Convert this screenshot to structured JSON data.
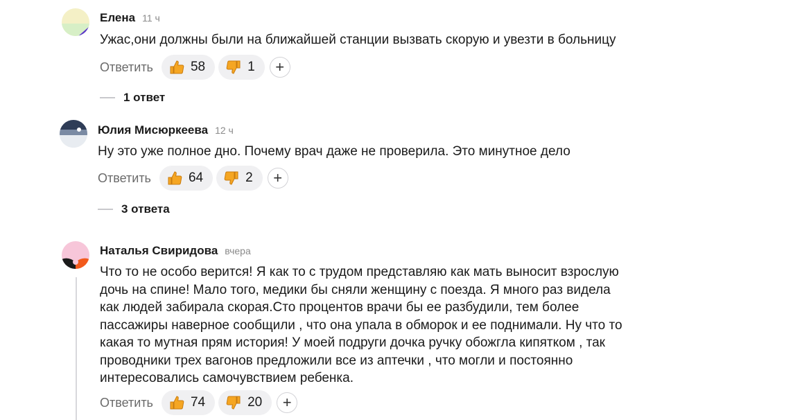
{
  "comments": [
    {
      "author": "Елена",
      "time": "11 ч",
      "text": "Ужас,они должны были на ближайшей станции вызвать скорую и увезти в больницу",
      "reply_label": "Ответить",
      "likes": "58",
      "dislikes": "1",
      "replies": "1 ответ"
    },
    {
      "author": "Юлия Мисюркеева",
      "time": "12 ч",
      "text": "Ну это уже полное дно. Почему врач даже не проверила. Это минутное дело",
      "reply_label": "Ответить",
      "likes": "64",
      "dislikes": "2",
      "replies": "3 ответа"
    },
    {
      "author": "Наталья Свиридова",
      "time": "вчера",
      "lines": [
        "Что то не особо верится! Я как то с трудом представляю как мать выносит взрослую",
        "дочь на спине! Мало того, медики бы сняли женщину с поезда. Я много раз видела",
        "как людей забирала скорая.Сто процентов врачи бы ее разбудили, тем более",
        "пассажиры наверное сообщили , что она упала в обморок и ее поднимали. Ну что то",
        "какая то мутная прям история! У моей подруги дочка ручку обожгла кипятком , так",
        "проводники трех вагонов предложили все из аптечки , что могли и постоянно",
        "интересовались самочувствием ребенка."
      ],
      "reply_label": "Ответить",
      "likes": "74",
      "dislikes": "20"
    }
  ],
  "icons": {
    "like": "thumbs-up-icon",
    "dislike": "thumbs-down-icon",
    "add_reaction": "plus-icon"
  },
  "colors": {
    "pill_bg": "#f0f0f2",
    "thumb": "#f5a623",
    "muted": "#6a6a6a"
  }
}
